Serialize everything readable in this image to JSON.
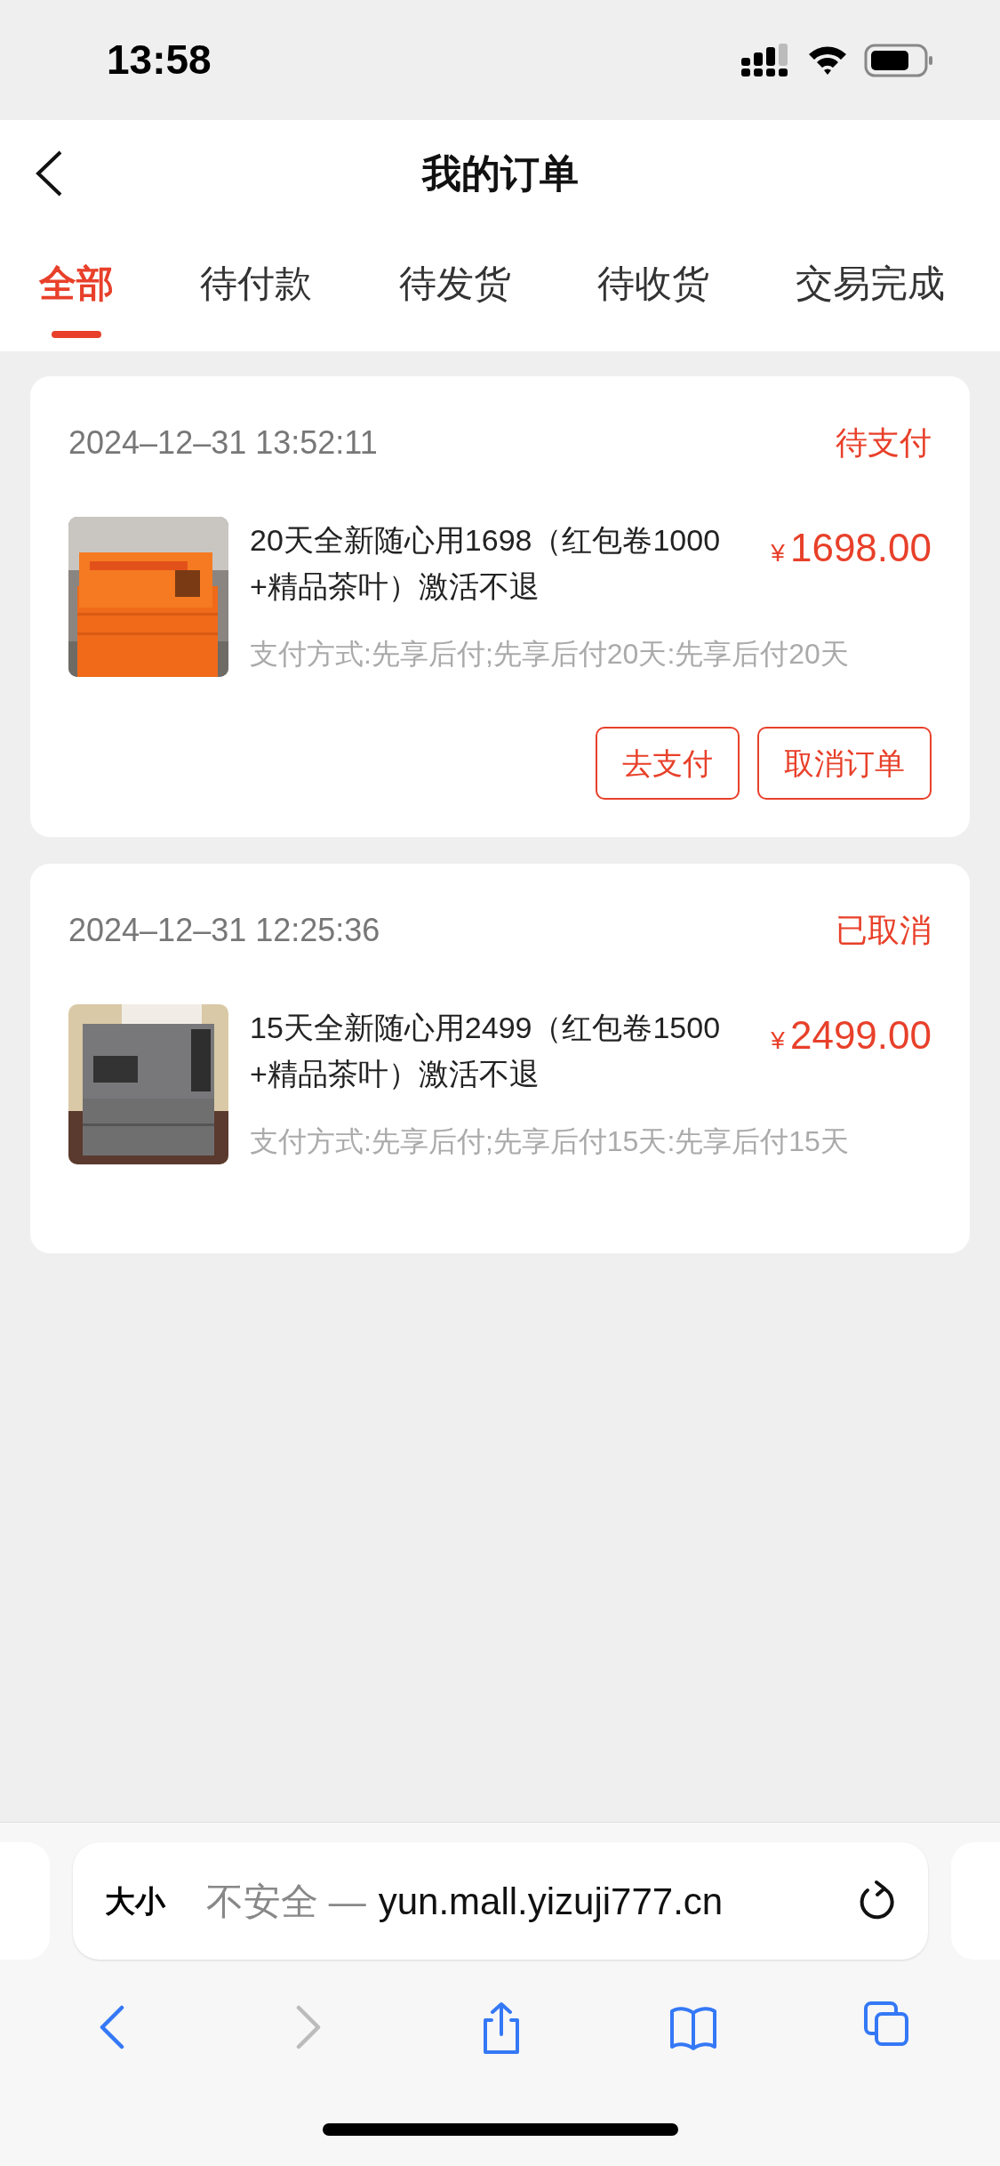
{
  "status_bar": {
    "time": "13:58"
  },
  "header": {
    "title": "我的订单"
  },
  "tabs": [
    {
      "label": "全部",
      "selected": true
    },
    {
      "label": "待付款",
      "selected": false
    },
    {
      "label": "待发货",
      "selected": false
    },
    {
      "label": "待收货",
      "selected": false
    },
    {
      "label": "交易完成",
      "selected": false
    }
  ],
  "orders": [
    {
      "time": "2024–12–31 13:52:11",
      "status": "待支付",
      "product": "20天全新随心用1698（红包卷1000+精品茶叶）激活不退",
      "currency": "¥",
      "price": "1698.00",
      "payment": "支付方式:先享后付;先享后付20天:先享后付20天",
      "buttons": [
        "去支付",
        "取消订单"
      ]
    },
    {
      "time": "2024–12–31 12:25:36",
      "status": "已取消",
      "product": "15天全新随心用2499（红包卷1500+精品茶叶）激活不退",
      "currency": "¥",
      "price": "2499.00",
      "payment": "支付方式:先享后付;先享后付15天:先享后付15天"
    }
  ],
  "browser": {
    "text_size": "大小",
    "security": "不安全 —",
    "url": "yun.mall.yizuji777.cn",
    "toolbar": [
      {
        "kind": "back",
        "disabled": false
      },
      {
        "kind": "forward",
        "disabled": true
      },
      {
        "kind": "share",
        "disabled": false
      },
      {
        "kind": "bookmarks",
        "disabled": false
      },
      {
        "kind": "tabs",
        "disabled": false
      }
    ]
  }
}
